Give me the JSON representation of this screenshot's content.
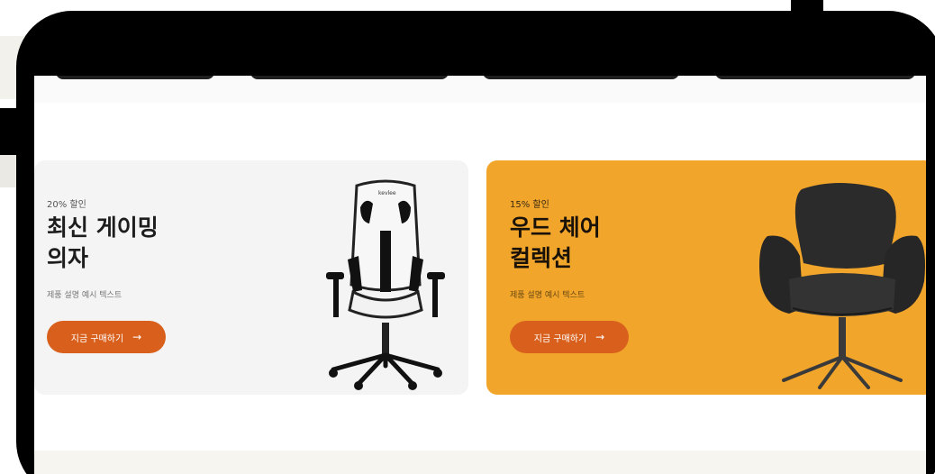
{
  "banners": [
    {
      "discount": "20% 할인",
      "title_line1": "최신 게이밍",
      "title_line2": "의자",
      "description": "제품 설명 예시 텍스트",
      "button_label": "지금 구매하기",
      "button_icon": "→",
      "background": "#f4f4f4"
    },
    {
      "discount": "15% 할인",
      "title_line1": "우드 체어",
      "title_line2": "컬렉션",
      "description": "제품 설명 예시 텍스트",
      "button_label": "지금 구매하기",
      "button_icon": "→",
      "background": "#f2a52b"
    }
  ],
  "colors": {
    "accent": "#d9601c",
    "frame": "#000000",
    "promo_orange": "#f2a52b"
  },
  "icons": {
    "button_arrow": "arrow-right-icon",
    "gaming_chair_logo": "brand-logo"
  },
  "gaming_chair_logo_text": "kevlee"
}
